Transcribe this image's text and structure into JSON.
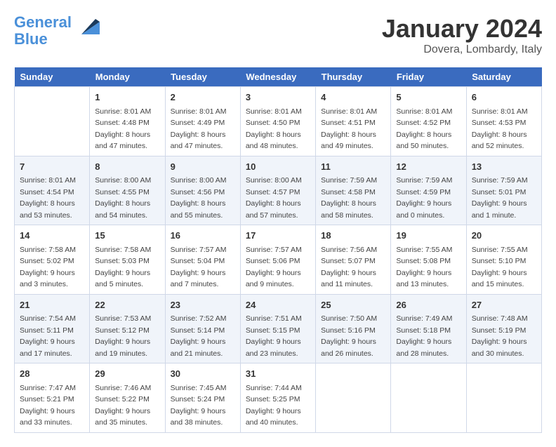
{
  "logo": {
    "line1": "General",
    "line2": "Blue"
  },
  "title": "January 2024",
  "location": "Dovera, Lombardy, Italy",
  "weekdays": [
    "Sunday",
    "Monday",
    "Tuesday",
    "Wednesday",
    "Thursday",
    "Friday",
    "Saturday"
  ],
  "weeks": [
    [
      {
        "day": "",
        "sunrise": "",
        "sunset": "",
        "daylight": ""
      },
      {
        "day": "1",
        "sunrise": "Sunrise: 8:01 AM",
        "sunset": "Sunset: 4:48 PM",
        "daylight": "Daylight: 8 hours and 47 minutes."
      },
      {
        "day": "2",
        "sunrise": "Sunrise: 8:01 AM",
        "sunset": "Sunset: 4:49 PM",
        "daylight": "Daylight: 8 hours and 47 minutes."
      },
      {
        "day": "3",
        "sunrise": "Sunrise: 8:01 AM",
        "sunset": "Sunset: 4:50 PM",
        "daylight": "Daylight: 8 hours and 48 minutes."
      },
      {
        "day": "4",
        "sunrise": "Sunrise: 8:01 AM",
        "sunset": "Sunset: 4:51 PM",
        "daylight": "Daylight: 8 hours and 49 minutes."
      },
      {
        "day": "5",
        "sunrise": "Sunrise: 8:01 AM",
        "sunset": "Sunset: 4:52 PM",
        "daylight": "Daylight: 8 hours and 50 minutes."
      },
      {
        "day": "6",
        "sunrise": "Sunrise: 8:01 AM",
        "sunset": "Sunset: 4:53 PM",
        "daylight": "Daylight: 8 hours and 52 minutes."
      }
    ],
    [
      {
        "day": "7",
        "sunrise": "Sunrise: 8:01 AM",
        "sunset": "Sunset: 4:54 PM",
        "daylight": "Daylight: 8 hours and 53 minutes."
      },
      {
        "day": "8",
        "sunrise": "Sunrise: 8:00 AM",
        "sunset": "Sunset: 4:55 PM",
        "daylight": "Daylight: 8 hours and 54 minutes."
      },
      {
        "day": "9",
        "sunrise": "Sunrise: 8:00 AM",
        "sunset": "Sunset: 4:56 PM",
        "daylight": "Daylight: 8 hours and 55 minutes."
      },
      {
        "day": "10",
        "sunrise": "Sunrise: 8:00 AM",
        "sunset": "Sunset: 4:57 PM",
        "daylight": "Daylight: 8 hours and 57 minutes."
      },
      {
        "day": "11",
        "sunrise": "Sunrise: 7:59 AM",
        "sunset": "Sunset: 4:58 PM",
        "daylight": "Daylight: 8 hours and 58 minutes."
      },
      {
        "day": "12",
        "sunrise": "Sunrise: 7:59 AM",
        "sunset": "Sunset: 4:59 PM",
        "daylight": "Daylight: 9 hours and 0 minutes."
      },
      {
        "day": "13",
        "sunrise": "Sunrise: 7:59 AM",
        "sunset": "Sunset: 5:01 PM",
        "daylight": "Daylight: 9 hours and 1 minute."
      }
    ],
    [
      {
        "day": "14",
        "sunrise": "Sunrise: 7:58 AM",
        "sunset": "Sunset: 5:02 PM",
        "daylight": "Daylight: 9 hours and 3 minutes."
      },
      {
        "day": "15",
        "sunrise": "Sunrise: 7:58 AM",
        "sunset": "Sunset: 5:03 PM",
        "daylight": "Daylight: 9 hours and 5 minutes."
      },
      {
        "day": "16",
        "sunrise": "Sunrise: 7:57 AM",
        "sunset": "Sunset: 5:04 PM",
        "daylight": "Daylight: 9 hours and 7 minutes."
      },
      {
        "day": "17",
        "sunrise": "Sunrise: 7:57 AM",
        "sunset": "Sunset: 5:06 PM",
        "daylight": "Daylight: 9 hours and 9 minutes."
      },
      {
        "day": "18",
        "sunrise": "Sunrise: 7:56 AM",
        "sunset": "Sunset: 5:07 PM",
        "daylight": "Daylight: 9 hours and 11 minutes."
      },
      {
        "day": "19",
        "sunrise": "Sunrise: 7:55 AM",
        "sunset": "Sunset: 5:08 PM",
        "daylight": "Daylight: 9 hours and 13 minutes."
      },
      {
        "day": "20",
        "sunrise": "Sunrise: 7:55 AM",
        "sunset": "Sunset: 5:10 PM",
        "daylight": "Daylight: 9 hours and 15 minutes."
      }
    ],
    [
      {
        "day": "21",
        "sunrise": "Sunrise: 7:54 AM",
        "sunset": "Sunset: 5:11 PM",
        "daylight": "Daylight: 9 hours and 17 minutes."
      },
      {
        "day": "22",
        "sunrise": "Sunrise: 7:53 AM",
        "sunset": "Sunset: 5:12 PM",
        "daylight": "Daylight: 9 hours and 19 minutes."
      },
      {
        "day": "23",
        "sunrise": "Sunrise: 7:52 AM",
        "sunset": "Sunset: 5:14 PM",
        "daylight": "Daylight: 9 hours and 21 minutes."
      },
      {
        "day": "24",
        "sunrise": "Sunrise: 7:51 AM",
        "sunset": "Sunset: 5:15 PM",
        "daylight": "Daylight: 9 hours and 23 minutes."
      },
      {
        "day": "25",
        "sunrise": "Sunrise: 7:50 AM",
        "sunset": "Sunset: 5:16 PM",
        "daylight": "Daylight: 9 hours and 26 minutes."
      },
      {
        "day": "26",
        "sunrise": "Sunrise: 7:49 AM",
        "sunset": "Sunset: 5:18 PM",
        "daylight": "Daylight: 9 hours and 28 minutes."
      },
      {
        "day": "27",
        "sunrise": "Sunrise: 7:48 AM",
        "sunset": "Sunset: 5:19 PM",
        "daylight": "Daylight: 9 hours and 30 minutes."
      }
    ],
    [
      {
        "day": "28",
        "sunrise": "Sunrise: 7:47 AM",
        "sunset": "Sunset: 5:21 PM",
        "daylight": "Daylight: 9 hours and 33 minutes."
      },
      {
        "day": "29",
        "sunrise": "Sunrise: 7:46 AM",
        "sunset": "Sunset: 5:22 PM",
        "daylight": "Daylight: 9 hours and 35 minutes."
      },
      {
        "day": "30",
        "sunrise": "Sunrise: 7:45 AM",
        "sunset": "Sunset: 5:24 PM",
        "daylight": "Daylight: 9 hours and 38 minutes."
      },
      {
        "day": "31",
        "sunrise": "Sunrise: 7:44 AM",
        "sunset": "Sunset: 5:25 PM",
        "daylight": "Daylight: 9 hours and 40 minutes."
      },
      {
        "day": "",
        "sunrise": "",
        "sunset": "",
        "daylight": ""
      },
      {
        "day": "",
        "sunrise": "",
        "sunset": "",
        "daylight": ""
      },
      {
        "day": "",
        "sunrise": "",
        "sunset": "",
        "daylight": ""
      }
    ]
  ]
}
